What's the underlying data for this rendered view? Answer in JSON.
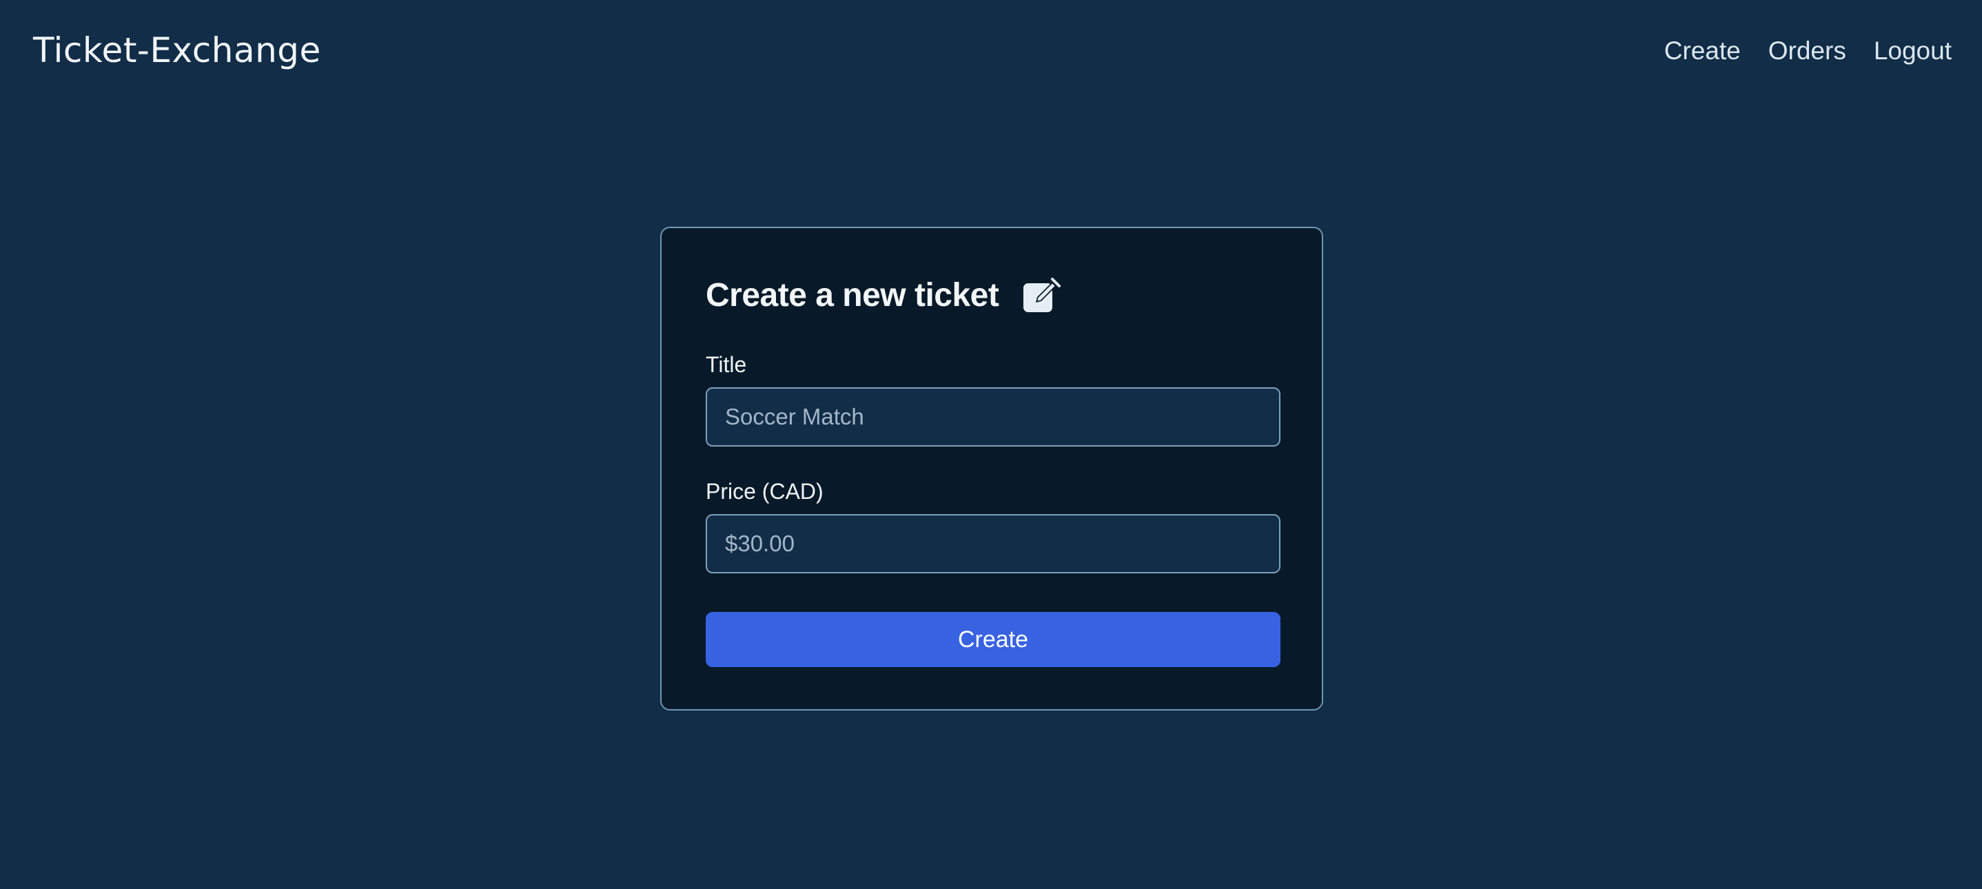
{
  "header": {
    "brand": "Ticket-Exchange",
    "nav": [
      {
        "label": "Create"
      },
      {
        "label": "Orders"
      },
      {
        "label": "Logout"
      }
    ]
  },
  "form": {
    "title": "Create a new ticket",
    "title_icon": "edit-square-icon",
    "fields": [
      {
        "label": "Title",
        "placeholder": "Soccer Match",
        "value": ""
      },
      {
        "label": "Price (CAD)",
        "placeholder": "$30.00",
        "value": ""
      }
    ],
    "submit_label": "Create"
  },
  "colors": {
    "page_background": "#112d48",
    "card_background": "#081a29",
    "card_border": "#6e96b7",
    "input_background": "#112d48",
    "accent": "#3763e3"
  }
}
